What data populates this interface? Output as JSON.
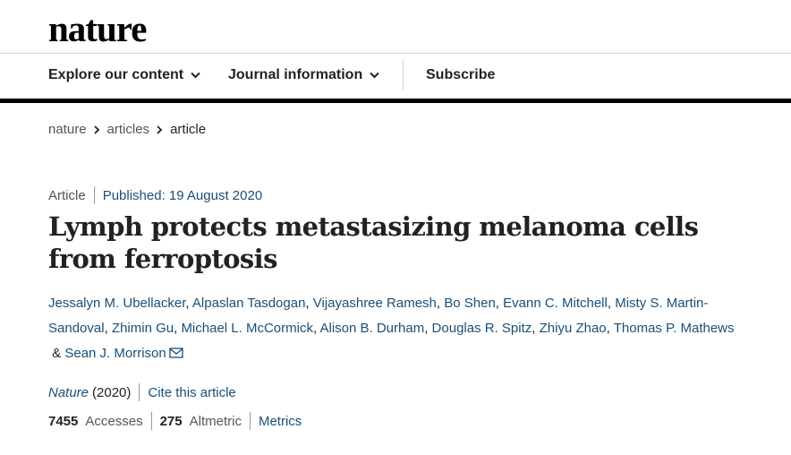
{
  "header": {
    "logo": "nature"
  },
  "nav": {
    "explore": "Explore our content",
    "journal_info": "Journal information",
    "subscribe": "Subscribe"
  },
  "breadcrumb": {
    "items": [
      "nature",
      "articles",
      "article"
    ]
  },
  "article": {
    "type": "Article",
    "published": "Published: 19 August 2020",
    "title": "Lymph protects metastasizing melanoma cells from ferroptosis",
    "authors": [
      "Jessalyn M. Ubellacker",
      "Alpaslan Tasdogan",
      "Vijayashree Ramesh",
      "Bo Shen",
      "Evann C. Mitchell",
      "Misty S. Martin-Sandoval",
      "Zhimin Gu",
      "Michael L. McCormick",
      "Alison B. Durham",
      "Douglas R. Spitz",
      "Zhiyu Zhao",
      "Thomas P. Mathews",
      "Sean J. Morrison"
    ],
    "author_separator": ", ",
    "author_last_joiner": " & ",
    "journal": "Nature",
    "year": "(2020)",
    "cite": "Cite this article"
  },
  "metrics": {
    "accesses_value": "7455",
    "accesses_label": "Accesses",
    "altmetric_value": "275",
    "altmetric_label": "Altmetric",
    "metrics_link": "Metrics"
  },
  "icons": {
    "nav_dropdown": "chevron-down-icon",
    "breadcrumb_sep": "chevron-right-icon",
    "corresponding": "envelope-icon"
  },
  "colors": {
    "link": "#1a4f78",
    "text": "#222222",
    "muted": "#555555",
    "bar": "#000000"
  }
}
